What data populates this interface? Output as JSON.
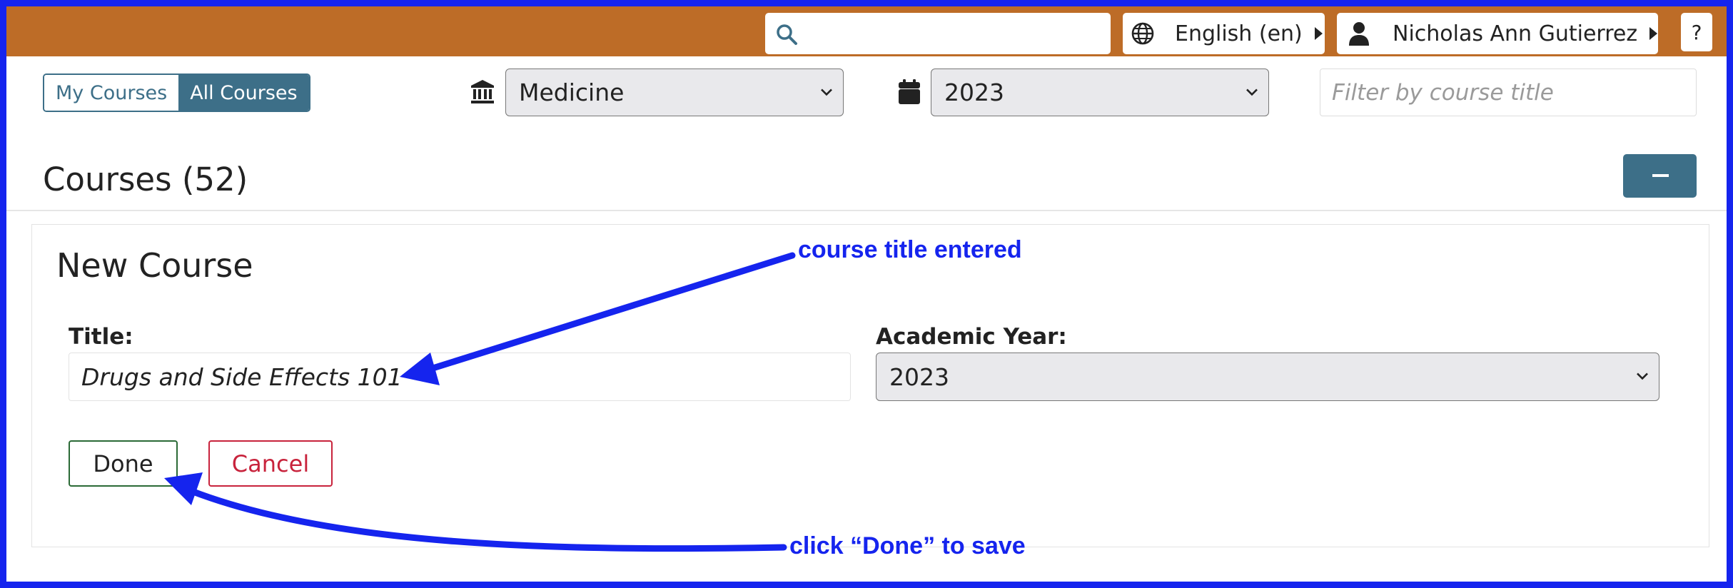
{
  "header": {
    "search_placeholder": "",
    "language_label": "English (en)",
    "user_label": "Nicholas Ann Gutierrez",
    "help_label": "?"
  },
  "filters": {
    "my_courses_label": "My Courses",
    "all_courses_label": "All Courses",
    "school_value": "Medicine",
    "year_value": "2023",
    "course_filter_placeholder": "Filter by course title"
  },
  "courses": {
    "heading": "Courses (52)"
  },
  "new_course": {
    "heading": "New Course",
    "title_label": "Title:",
    "title_value": "Drugs and Side Effects 101",
    "academic_year_label": "Academic Year:",
    "academic_year_value": "2023",
    "done_label": "Done",
    "cancel_label": "Cancel"
  },
  "annotations": {
    "title_note": "course title entered",
    "done_note": "click “Done” to save",
    "color": "#1524ee"
  },
  "colors": {
    "topbar": "#bd6c27",
    "accent": "#3d6f88",
    "done_border": "#2b6a36",
    "cancel": "#c8233c"
  },
  "icons": {
    "search": "search-icon",
    "language": "globe-icon",
    "user": "user-icon",
    "school": "building-columns-icon",
    "calendar": "calendar-icon"
  }
}
